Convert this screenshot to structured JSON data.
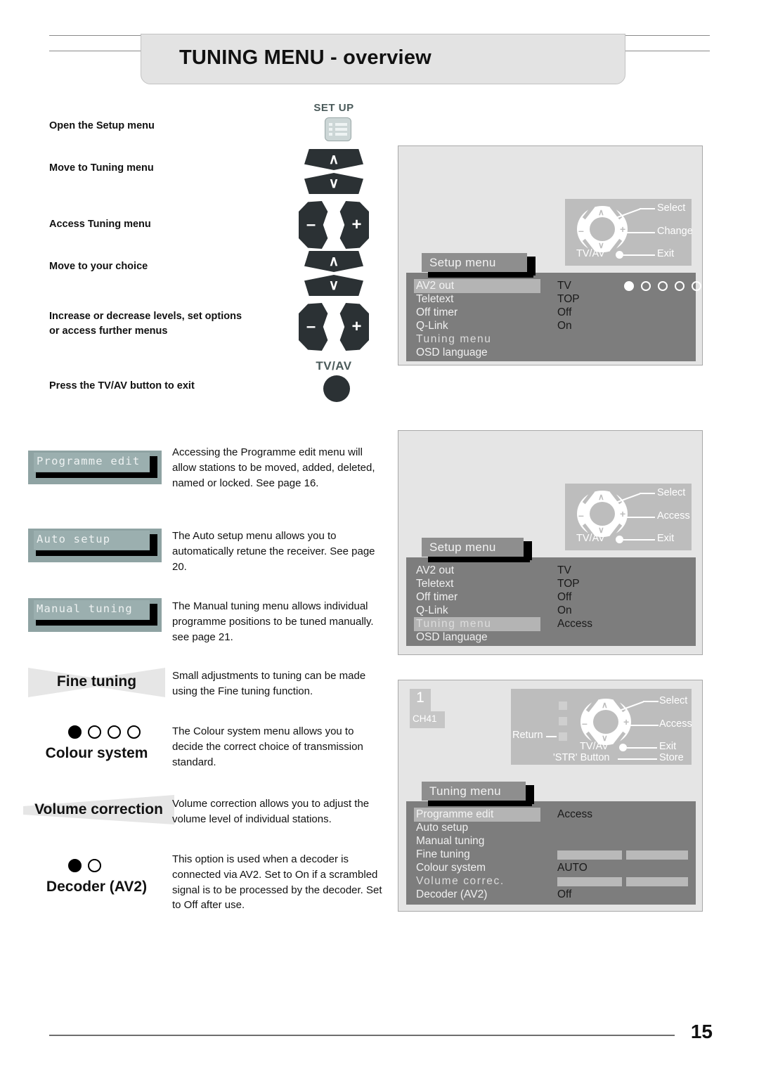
{
  "header": {
    "title": "TUNING MENU - overview"
  },
  "instructions": [
    {
      "text": "Open the Setup menu"
    },
    {
      "text": "Move to Tuning menu"
    },
    {
      "text": "Access Tuning menu"
    },
    {
      "text": "Move to your choice"
    },
    {
      "text": "Increase or decrease levels, set options or access further menus"
    },
    {
      "text": "Press the TV/AV button to exit"
    }
  ],
  "remote": {
    "setup_label": "SET UP",
    "tvav_label": "TV/AV",
    "up_glyph": "∧",
    "down_glyph": "∨",
    "minus_glyph": "–",
    "plus_glyph": "+"
  },
  "features": [
    {
      "label": "Programme edit",
      "style": "box",
      "description": "Accessing the Programme edit menu will allow stations to be moved, added, deleted, named or locked. See page 16."
    },
    {
      "label": "Auto setup",
      "style": "box",
      "description": "The Auto setup menu allows you to automatically retune the receiver. See page 20."
    },
    {
      "label": "Manual tuning",
      "style": "box",
      "description": "The Manual tuning menu allows individual programme positions to be tuned manually. see page 21."
    },
    {
      "label": "Fine tuning",
      "style": "bowtie",
      "description": "Small adjustments to tuning can be made using the Fine tuning function."
    },
    {
      "label": "Colour system",
      "style": "dots",
      "dots_total": 4,
      "dots_filled": 1,
      "description": "The Colour system menu allows you to decide the correct choice of transmission standard."
    },
    {
      "label": "Volume correction",
      "style": "wedge",
      "description": "Volume correction allows you to adjust the volume level of individual stations."
    },
    {
      "label": "Decoder (AV2)",
      "style": "dots",
      "dots_total": 2,
      "dots_filled": 1,
      "description": "This option is used when a decoder is connected via AV2. Set to On if a scrambled signal is to be processed by the decoder. Set to Off after use."
    }
  ],
  "panels": [
    {
      "menu_title": "Setup menu",
      "legend": {
        "select": "Select",
        "change": "Change",
        "exit": "Exit",
        "tvav": "TV/AV"
      },
      "indicator_dots": {
        "total": 5,
        "filled": 1
      },
      "rows": [
        {
          "label": "AV2 out",
          "value": "TV",
          "highlight": true,
          "dim": false
        },
        {
          "label": "Teletext",
          "value": "TOP",
          "highlight": false,
          "dim": false
        },
        {
          "label": "Off timer",
          "value": "Off",
          "highlight": false,
          "dim": false
        },
        {
          "label": "Q-Link",
          "value": "On",
          "highlight": false,
          "dim": false
        },
        {
          "label": "Tuning menu",
          "value": "",
          "highlight": false,
          "dim": true
        },
        {
          "label": "OSD language",
          "value": "",
          "highlight": false,
          "dim": false
        }
      ]
    },
    {
      "menu_title": "Setup menu",
      "legend": {
        "select": "Select",
        "change": "Access",
        "exit": "Exit",
        "tvav": "TV/AV"
      },
      "rows": [
        {
          "label": "AV2 out",
          "value": "TV",
          "highlight": false,
          "dim": false
        },
        {
          "label": "Teletext",
          "value": "TOP",
          "highlight": false,
          "dim": false
        },
        {
          "label": "Off timer",
          "value": "Off",
          "highlight": false,
          "dim": false
        },
        {
          "label": "Q-Link",
          "value": "On",
          "highlight": false,
          "dim": false
        },
        {
          "label": "Tuning menu",
          "value": "Access",
          "highlight": true,
          "dim": true
        },
        {
          "label": "OSD language",
          "value": "",
          "highlight": false,
          "dim": false
        }
      ]
    },
    {
      "menu_title": "Tuning menu",
      "channel_badge": {
        "number": "1",
        "channel": "CH41"
      },
      "legend": {
        "select": "Select",
        "change": "Access",
        "exit": "Exit",
        "tvav": "TV/AV",
        "return": "Return",
        "store": "Store",
        "str_button": "'STR' Button"
      },
      "rows": [
        {
          "label": "Programme edit",
          "value": "Access",
          "highlight": true,
          "dim": false,
          "bars": false
        },
        {
          "label": "Auto setup",
          "value": "",
          "highlight": false,
          "dim": false,
          "bars": false
        },
        {
          "label": "Manual tuning",
          "value": "",
          "highlight": false,
          "dim": false,
          "bars": false
        },
        {
          "label": "Fine tuning",
          "value": "",
          "highlight": false,
          "dim": false,
          "bars": true
        },
        {
          "label": "Colour system",
          "value": "AUTO",
          "highlight": false,
          "dim": false,
          "bars": false
        },
        {
          "label": "Volume correc.",
          "value": "",
          "highlight": false,
          "dim": true,
          "bars": true
        },
        {
          "label": "Decoder (AV2)",
          "value": "Off",
          "highlight": false,
          "dim": false,
          "bars": false
        }
      ]
    }
  ],
  "footer": {
    "page_number": "15"
  }
}
